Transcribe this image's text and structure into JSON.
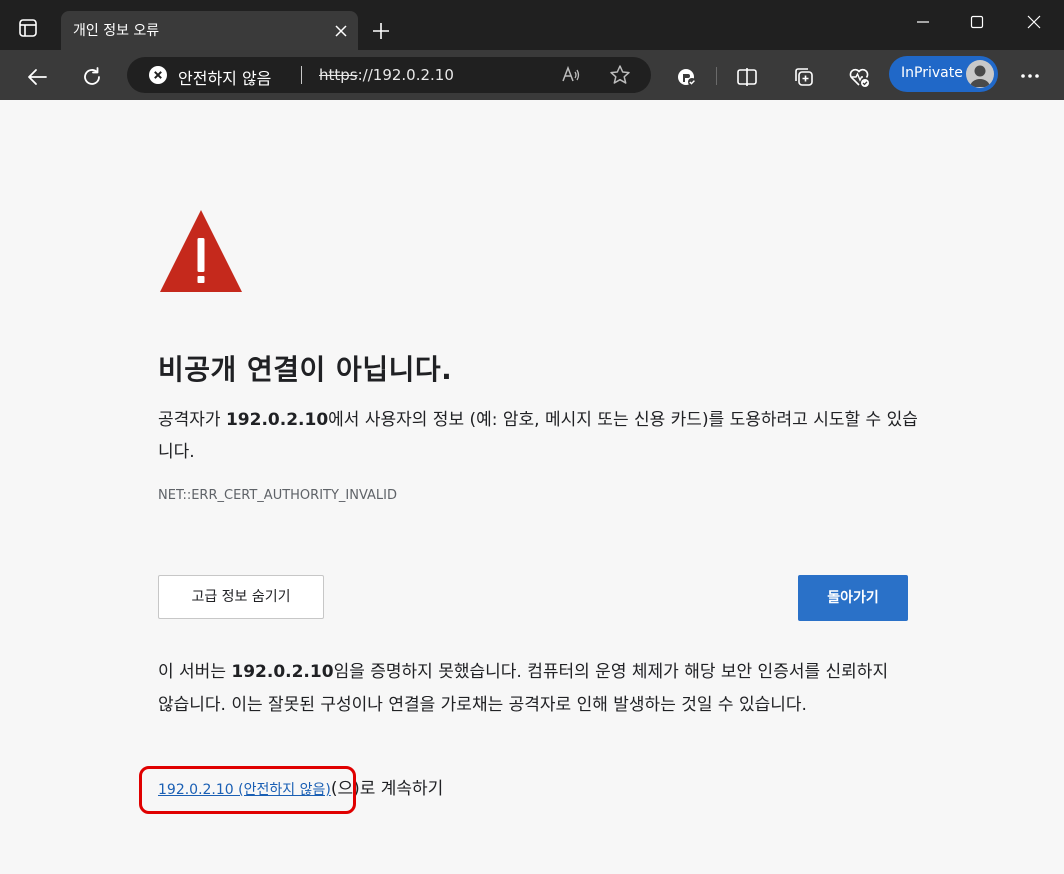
{
  "window": {
    "tab_title": "개인 정보 오류",
    "controls": [
      "minimize",
      "maximize",
      "close"
    ]
  },
  "toolbar": {
    "security_label": "안전하지 않음",
    "url_scheme": "https",
    "url_rest": "://192.0.2.10",
    "inprivate_label": "InPrivate"
  },
  "page": {
    "heading": "비공개 연결이 아닙니다.",
    "desc_before": "공격자가 ",
    "desc_host": "192.0.2.10",
    "desc_after": "에서 사용자의 정보 (예: 암호, 메시지 또는 신용 카드)를 도용하려고 시도할 수 있습니다.",
    "error_code": "NET::ERR_CERT_AUTHORITY_INVALID",
    "advanced_button": "고급 정보 숨기기",
    "back_button": "돌아가기",
    "details_before": "이 서버는 ",
    "details_host": "192.0.2.10",
    "details_after": "임을 증명하지 못했습니다. 컴퓨터의 운영 체제가 해당 보안 인증서를 신뢰하지 않습니다. 이는 잘못된 구성이나 연결을 가로채는 공격자로 인해 발생하는 것일 수 있습니다.",
    "proceed_link": "192.0.2.10 (안전하지 않음)",
    "proceed_suffix": "(으)로 계속하기"
  },
  "colors": {
    "warning_red": "#c5291c",
    "primary_button": "#2a71c8",
    "link": "#1a5fb4",
    "highlight": "#e00000",
    "inprivate_badge": "#2068c8"
  },
  "icons": [
    "tab-actions-icon",
    "close-icon",
    "plus-icon",
    "minimize-icon",
    "maximize-icon",
    "back-arrow-icon",
    "refresh-icon",
    "not-secure-icon",
    "read-aloud-icon",
    "favorite-star-icon",
    "tracking-prevention-icon",
    "split-screen-icon",
    "collections-icon",
    "browser-essentials-icon",
    "profile-avatar-icon",
    "more-icon",
    "warning-triangle-icon"
  ]
}
